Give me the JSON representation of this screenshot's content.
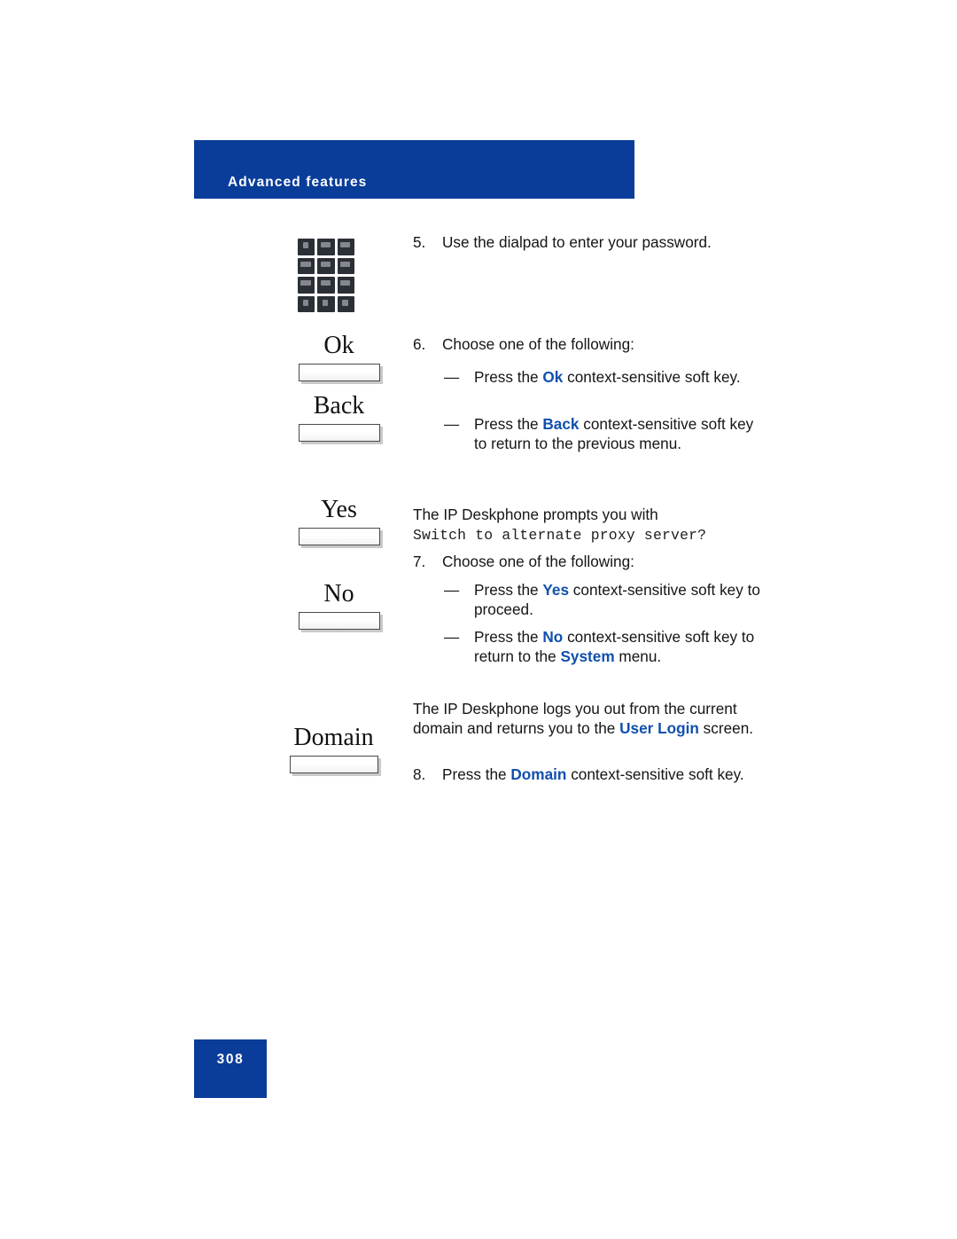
{
  "header": {
    "title": "Advanced features"
  },
  "illustrations": {
    "dialpad": {
      "icon": "dialpad-icon",
      "rows": 4,
      "columns": 3
    },
    "softkeys": [
      {
        "label": "Ok"
      },
      {
        "label": "Back"
      },
      {
        "label": "Yes"
      },
      {
        "label": "No"
      },
      {
        "label": "Domain"
      }
    ]
  },
  "content": {
    "step5": {
      "number": "5.",
      "text": "Use the dialpad to enter your password."
    },
    "step6": {
      "number": "6.",
      "text": "Choose one of the following:"
    },
    "bullet6a": {
      "dash": "—",
      "pre": "Press the ",
      "key": "Ok",
      "post": " context-sensitive soft key."
    },
    "bullet6b": {
      "dash": "—",
      "pre": "Press the ",
      "key": "Back",
      "post": " context-sensitive soft key to return to the previous menu."
    },
    "para1": {
      "text": "The IP Deskphone prompts you with"
    },
    "prompt": {
      "text": "Switch to alternate proxy server?"
    },
    "step7": {
      "number": "7.",
      "text": "Choose one of the following:"
    },
    "bullet7a": {
      "dash": "—",
      "pre": "Press the ",
      "key": "Yes",
      "post": " context-sensitive soft key to proceed."
    },
    "bullet7b": {
      "dash": "—",
      "pre": "Press the ",
      "key": "No",
      "post": " context-sensitive soft key to return to the ",
      "key2": "System",
      "post2": " menu."
    },
    "para2": {
      "pre": "The IP Deskphone logs you out from the current domain and returns you to the ",
      "key": "User Login",
      "post": " screen."
    },
    "step8": {
      "number": "8.",
      "pre": "Press the ",
      "key": "Domain",
      "post": " context-sensitive soft key."
    }
  },
  "footer": {
    "page_number": "308"
  },
  "colors": {
    "brand_blue": "#0a3d99",
    "keyword_blue": "#1250ad"
  }
}
